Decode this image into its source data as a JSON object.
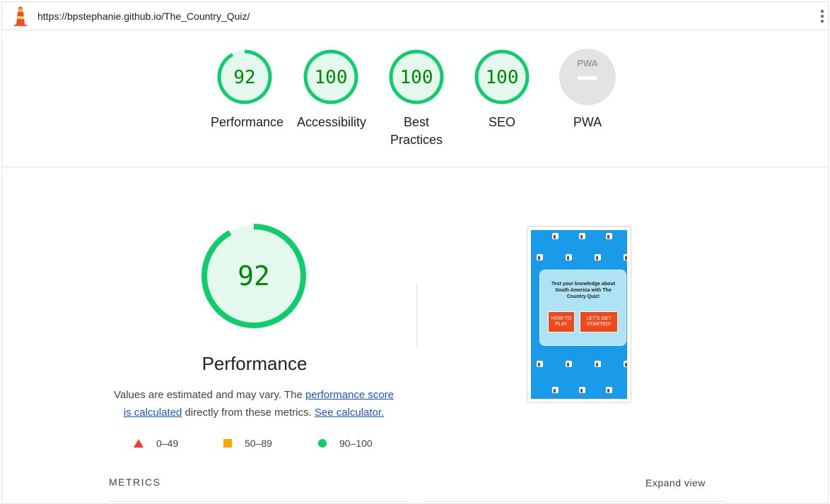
{
  "topbar": {
    "url": "https://bpstephanie.github.io/The_Country_Quiz/"
  },
  "gauges": [
    {
      "score": "92",
      "label": "Performance"
    },
    {
      "score": "100",
      "label": "Accessibility"
    },
    {
      "score": "100",
      "label": "Best Practices"
    },
    {
      "score": "100",
      "label": "SEO"
    },
    {
      "score": "PWA",
      "label": "PWA"
    }
  ],
  "performance": {
    "score": "92",
    "title": "Performance",
    "desc_prefix": "Values are estimated and may vary. The ",
    "link_score": "performance score is calculated",
    "desc_middle": " directly from these metrics. ",
    "link_calc": "See calculator."
  },
  "legend": {
    "fail": "0–49",
    "average": "50–89",
    "pass": "90–100"
  },
  "screenshot": {
    "card_text": "Test your knowledge about South America with The Country Quiz!",
    "how_to_play": "HOW TO PLAY",
    "get_started": "LET'S GET STARTED!"
  },
  "metrics": {
    "heading": "METRICS",
    "expand": "Expand view"
  },
  "colors": {
    "pass": "#0cce6b",
    "pass_text": "#008800",
    "pass_bg": "#e5f8ee",
    "average": "#ffa400",
    "fail": "#ff3333",
    "link": "#1a53d9"
  }
}
